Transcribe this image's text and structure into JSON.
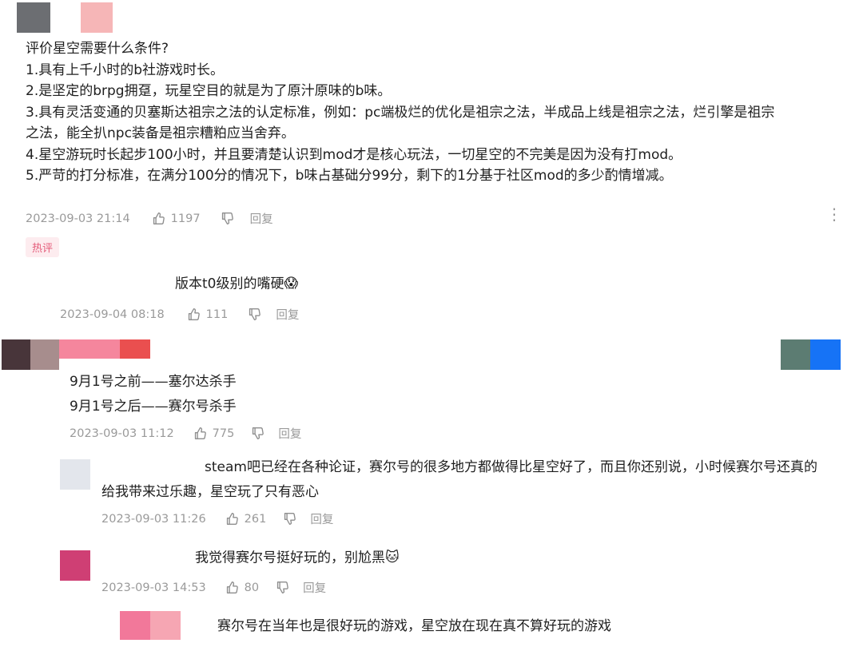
{
  "colors": {
    "meta_text": "#9a9a9a",
    "badge_bg": "#fdecef",
    "badge_text": "#e45b79",
    "body_text": "#1f1f1f"
  },
  "main_comment": {
    "lines": [
      "评价星空需要什么条件?",
      "1.具有上千小时的b社游戏时长。",
      "2.是坚定的brpg拥趸，玩星空目的就是为了原汁原味的b味。",
      "3.具有灵活变通的贝塞斯达祖宗之法的认定标准，例如：pc端极烂的优化是祖宗之法，半成品上线是祖宗之法，烂引擎是祖宗",
      "之法，能全扒npc装备是祖宗糟粕应当舍弃。",
      "4.星空游玩时长起步100小时，并且要清楚认识到mod才是核心玩法，一切星空的不完美是因为没有打mod。",
      "5.严苛的打分标准，在满分100分的情况下，b味占基础分99分，剩下的1分基于社区mod的多少酌情增减。"
    ],
    "time": "2023-09-03 21:14",
    "likes": "1197",
    "reply_label": "回复",
    "badge": "热评",
    "more_icon": "more-vertical-icon"
  },
  "reply1": {
    "text": "版本t0级别的嘴硬",
    "emoji": "😱",
    "time": "2023-09-04 08:18",
    "likes": "111",
    "reply_label": "回复"
  },
  "comment2": {
    "line1": "9月1号之前——塞尔达杀手",
    "line2": "9月1号之后——赛尔号杀手",
    "time": "2023-09-03 11:12",
    "likes": "775",
    "reply_label": "回复"
  },
  "reply2": {
    "line1": "steam吧已经在各种论证，赛尔号的很多地方都做得比星空好了，而且你还别说，小时候赛尔号还真的",
    "line2": "给我带来过乐趣，星空玩了只有恶心",
    "time": "2023-09-03 11:26",
    "likes": "261",
    "reply_label": "回复"
  },
  "reply3": {
    "text": "我觉得赛尔号挺好玩的，别尬黑",
    "emoji": "🐱",
    "time": "2023-09-03 14:53",
    "likes": "80",
    "reply_label": "回复"
  },
  "reply4": {
    "text": "赛尔号在当年也是很好玩的游戏，星空放在现在真不算好玩的游戏"
  }
}
